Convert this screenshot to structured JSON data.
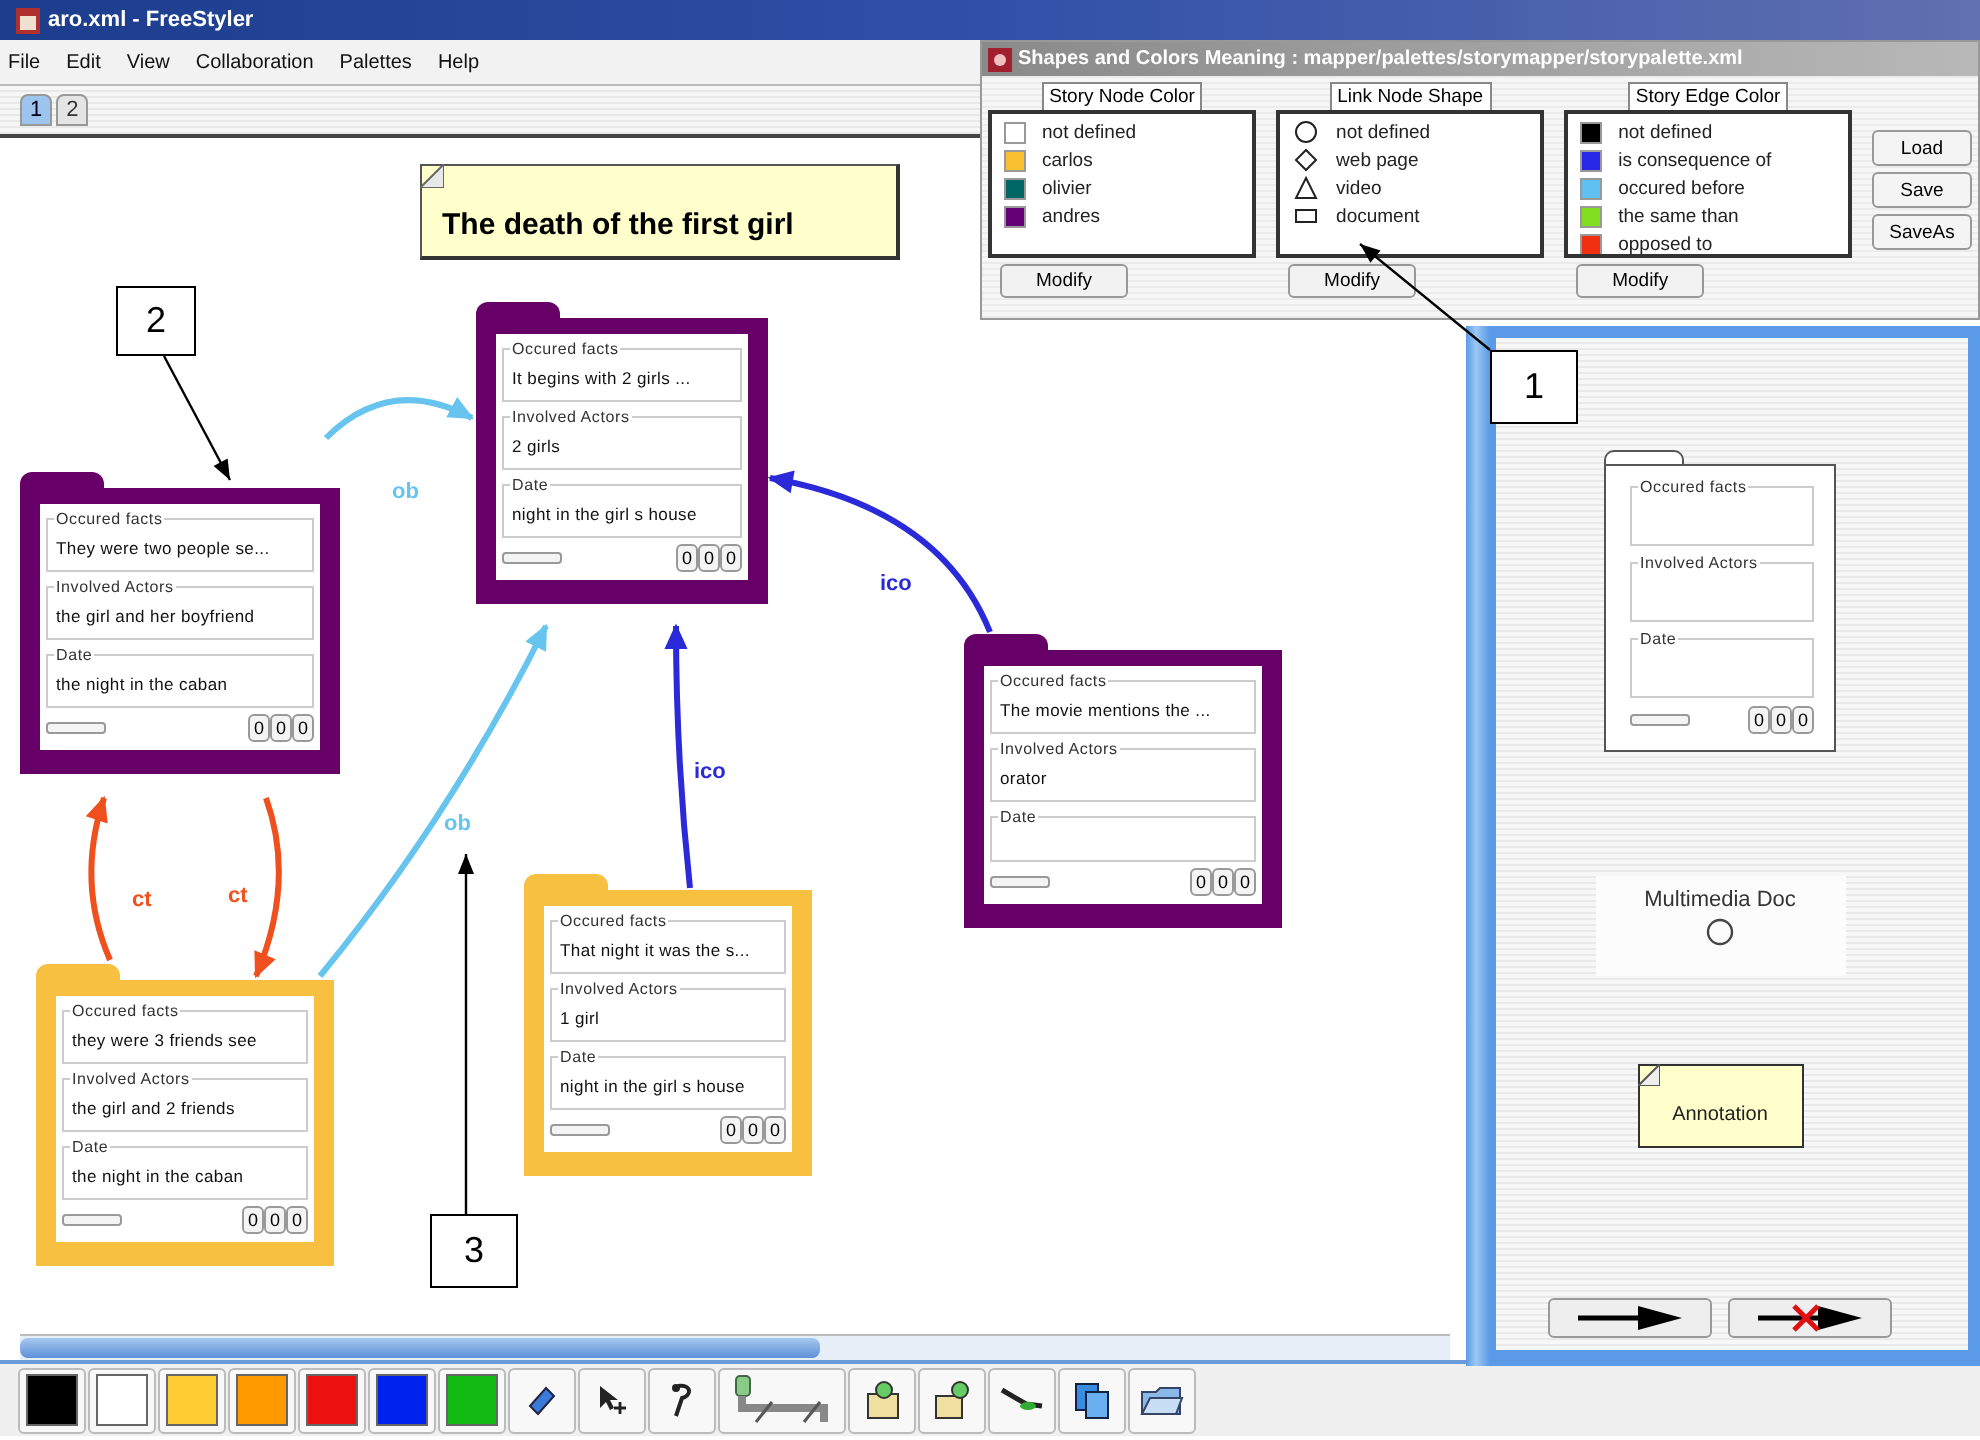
{
  "window": {
    "title": "aro.xml - FreeStyler"
  },
  "menu": [
    "File",
    "Edit",
    "View",
    "Collaboration",
    "Palettes",
    "Help"
  ],
  "tabs": [
    {
      "label": "1",
      "selected": true
    },
    {
      "label": "2",
      "selected": false
    }
  ],
  "canvas": {
    "title_note": "The death of the first girl",
    "nodes": [
      {
        "color": "#660066",
        "fields": [
          {
            "label": "Occured facts",
            "value": "They were two people se..."
          },
          {
            "label": "Involved Actors",
            "value": "the girl and her boyfriend"
          },
          {
            "label": "Date",
            "value": "the night in the caban"
          }
        ],
        "counters": [
          "0",
          "0",
          "0"
        ]
      },
      {
        "color": "#660066",
        "fields": [
          {
            "label": "Occured facts",
            "value": "It begins with 2 girls ..."
          },
          {
            "label": "Involved Actors",
            "value": "2 girls"
          },
          {
            "label": "Date",
            "value": "night in the girl s house"
          }
        ],
        "counters": [
          "0",
          "0",
          "0"
        ]
      },
      {
        "color": "#660066",
        "fields": [
          {
            "label": "Occured facts",
            "value": "The movie mentions the ..."
          },
          {
            "label": "Involved Actors",
            "value": "orator"
          },
          {
            "label": "Date"
          }
        ],
        "counters": [
          "0",
          "0",
          "0"
        ]
      },
      {
        "color": "#f8c040",
        "fields": [
          {
            "label": "Occured facts",
            "value": "they were 3 friends see"
          },
          {
            "label": "Involved Actors",
            "value": "the girl and 2 friends"
          },
          {
            "label": "Date",
            "value": "the night in the caban"
          }
        ],
        "counters": [
          "0",
          "0",
          "0"
        ]
      },
      {
        "color": "#f8c040",
        "fields": [
          {
            "label": "Occured facts",
            "value": "That night it was the s..."
          },
          {
            "label": "Involved Actors",
            "value": "1 girl"
          },
          {
            "label": "Date",
            "value": "night in the girl s house"
          }
        ],
        "counters": [
          "0",
          "0",
          "0"
        ]
      }
    ],
    "edges": [
      {
        "label": "ob",
        "color": "#66c4ee"
      },
      {
        "label": "ob",
        "color": "#66c4ee"
      },
      {
        "label": "ico",
        "color": "#2a2ad8"
      },
      {
        "label": "ico",
        "color": "#2a2ad8"
      },
      {
        "label": "ct",
        "color": "#f0501e"
      },
      {
        "label": "ct",
        "color": "#f0501e"
      }
    ],
    "callouts": [
      "2",
      "3",
      "1"
    ]
  },
  "palette_dialog": {
    "title": "Shapes and Colors Meaning : mapper/palettes/storymapper/storypalette.xml",
    "groups": [
      {
        "title": "Story Node Color",
        "kind": "color",
        "button": "Modify",
        "items": [
          {
            "name": "not defined",
            "color": "#ffffff"
          },
          {
            "name": "carlos",
            "color": "#f8c030"
          },
          {
            "name": "olivier",
            "color": "#006666"
          },
          {
            "name": "andres",
            "color": "#660077"
          }
        ]
      },
      {
        "title": "Link Node Shape",
        "kind": "shape",
        "button": "Modify",
        "items": [
          {
            "name": "not defined",
            "kind": "circle"
          },
          {
            "name": "web page",
            "kind": "diamond"
          },
          {
            "name": "video",
            "kind": "triangle"
          },
          {
            "name": "document",
            "kind": "rect"
          }
        ]
      },
      {
        "title": "Story Edge Color",
        "kind": "color",
        "button": "Modify",
        "items": [
          {
            "name": "not defined",
            "color": "#000000"
          },
          {
            "name": "is consequence of",
            "color": "#2828e8"
          },
          {
            "name": "occured before",
            "color": "#60c0f0"
          },
          {
            "name": "the same than",
            "color": "#80e020"
          },
          {
            "name": "opposed to",
            "color": "#f03010"
          }
        ]
      }
    ],
    "side_buttons": [
      "Load",
      "Save",
      "SaveAs"
    ]
  },
  "node_palette": {
    "template_fields": [
      "Occured facts",
      "Involved Actors",
      "Date"
    ],
    "counters": [
      "0",
      "0",
      "0"
    ],
    "multimedia": "Multimedia Doc",
    "annotation": "Annotation"
  },
  "toolbar": {
    "colors": [
      {
        "color": "#000000"
      },
      {
        "color": "#ffffff"
      },
      {
        "color": "#ffcc33"
      },
      {
        "color": "#ff9900"
      },
      {
        "color": "#ee1111"
      },
      {
        "color": "#0022ee"
      },
      {
        "color": "#11bb11"
      }
    ]
  }
}
